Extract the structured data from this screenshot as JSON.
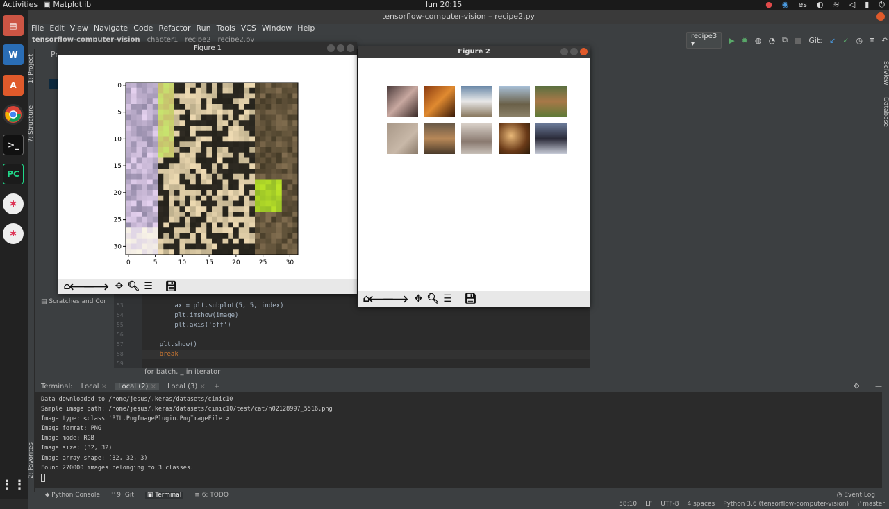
{
  "topbar": {
    "activities": "Activities",
    "app_name": "Matplotlib",
    "clock": "lun 20:15",
    "lang": "es"
  },
  "ide": {
    "window_title": "tensorflow-computer-vision – recipe2.py",
    "menu": [
      "File",
      "Edit",
      "View",
      "Navigate",
      "Code",
      "Refactor",
      "Run",
      "Tools",
      "VCS",
      "Window",
      "Help"
    ],
    "nav": [
      "tensorflow-computer-vision",
      "chapter1",
      "recipe2",
      "recipe2.py"
    ],
    "run_config": "recipe3",
    "git_label": "Git:",
    "left_tabs": [
      "1: Project",
      "7: Structure",
      "2: Favorites"
    ],
    "right_tabs": [
      "SciView",
      "Database"
    ],
    "project_items": [
      "Pr",
      "Scratches and Cor"
    ],
    "code_lines": [
      {
        "num": "53",
        "text": "        ax = plt.subplot(5, 5, index)"
      },
      {
        "num": "54",
        "text": "        plt.imshow(image)"
      },
      {
        "num": "55",
        "text": "        plt.axis('off')"
      },
      {
        "num": "56",
        "text": ""
      },
      {
        "num": "57",
        "text": "    plt.show()"
      },
      {
        "num": "58",
        "text": "    break"
      },
      {
        "num": "59",
        "text": ""
      }
    ],
    "code_breadcrumb": "for batch, _ in iterator"
  },
  "terminal": {
    "title": "Terminal:",
    "tabs": [
      "Local",
      "Local (2)",
      "Local (3)"
    ],
    "active_tab": "Local (2)",
    "add_tab": "+",
    "lines": [
      "Data downloaded to /home/jesus/.keras/datasets/cinic10",
      "Sample image path: /home/jesus/.keras/datasets/cinic10/test/cat/n02128997_5516.png",
      "Image type: <class 'PIL.PngImagePlugin.PngImageFile'>",
      "Image format: PNG",
      "Image mode: RGB",
      "Image size: (32, 32)",
      "Image array shape: (32, 32, 3)",
      "Found 270000 images belonging to 3 classes."
    ]
  },
  "bottom_tabs": [
    "Python Console",
    "9: Git",
    "Terminal",
    "6: TODO"
  ],
  "event_log": "Event Log",
  "status": {
    "position": "58:10",
    "line_sep": "LF",
    "encoding": "UTF-8",
    "indent": "4 spaces",
    "interpreter": "Python 3.6 (tensorflow-computer-vision)",
    "branch": "master"
  },
  "figure1": {
    "title": "Figure 1",
    "xticks": [
      "0",
      "5",
      "10",
      "15",
      "20",
      "25",
      "30"
    ],
    "yticks": [
      "0",
      "5",
      "10",
      "15",
      "20",
      "25",
      "30"
    ]
  },
  "figure2": {
    "title": "Figure 2"
  },
  "colors": {
    "accent": "#e05a2b",
    "editor_bg": "#2b2b2b",
    "panel_bg": "#3c3f41"
  }
}
